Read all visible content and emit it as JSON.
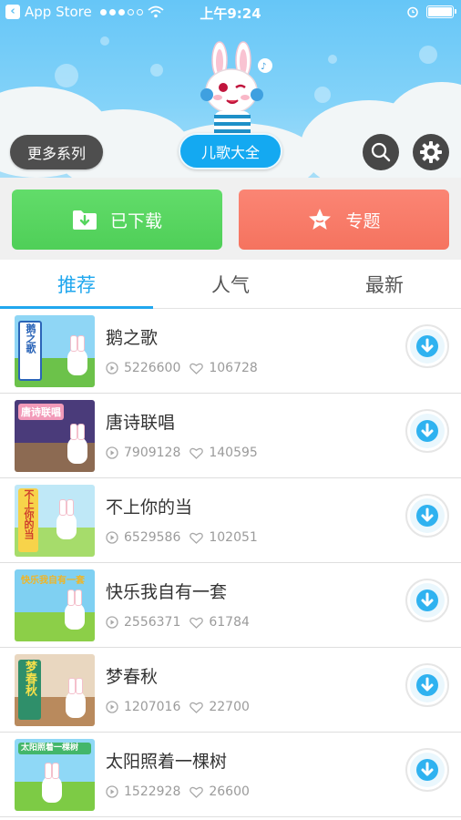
{
  "status_bar": {
    "back_app": "App Store",
    "time": "上午9:24",
    "signal_bars": 3,
    "signal_total": 5
  },
  "header": {
    "more_series_label": "更多系列",
    "center_label": "儿歌大全",
    "search_icon": "search-icon",
    "settings_icon": "gear-icon"
  },
  "actions": {
    "downloaded_label": "已下载",
    "topics_label": "专题"
  },
  "tabs": [
    {
      "label": "推荐",
      "active": true
    },
    {
      "label": "人气",
      "active": false
    },
    {
      "label": "最新",
      "active": false
    }
  ],
  "songs": [
    {
      "title": "鹅之歌",
      "plays": "5226600",
      "likes": "106728",
      "badge": "鹅之歌"
    },
    {
      "title": "唐诗联唱",
      "plays": "7909128",
      "likes": "140595",
      "badge": "唐诗联唱"
    },
    {
      "title": "不上你的当",
      "plays": "6529586",
      "likes": "102051",
      "badge": "不上你的当"
    },
    {
      "title": "快乐我自有一套",
      "plays": "2556371",
      "likes": "61784",
      "badge": "快乐我自有一套"
    },
    {
      "title": "梦春秋",
      "plays": "1207016",
      "likes": "22700",
      "badge": "梦春秋"
    },
    {
      "title": "太阳照着一棵树",
      "plays": "1522928",
      "likes": "26600",
      "badge": "太阳照着一棵树"
    }
  ],
  "colors": {
    "sky": "#66c6f7",
    "accent_blue": "#20a7ee",
    "download_green": "#55d55e",
    "topic_red": "#f77b68",
    "dark_pill": "#4e4e4e"
  }
}
